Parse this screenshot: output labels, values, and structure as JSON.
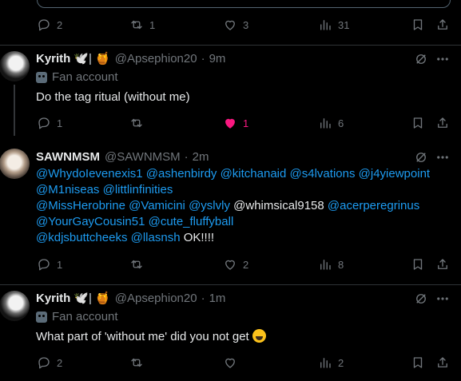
{
  "top_tweet": {
    "actions": {
      "replies": "2",
      "retweets": "1",
      "likes": "3",
      "views": "31"
    }
  },
  "tweets": [
    {
      "name": "Kyrith",
      "name_decor": "🕊️| 🍯",
      "handle": "@Apsephion20",
      "time": "9m",
      "label": "Fan account",
      "text": "Do the tag ritual (without me)",
      "actions": {
        "replies": "1",
        "retweets": "",
        "likes": "1",
        "views": "6"
      },
      "liked": true
    },
    {
      "name": "SAWNMSM",
      "handle": "@SAWNMSM",
      "time": "2m",
      "mentions_line1": [
        "@WhydoIevenexis1",
        "@ashenbirdy",
        "@kitchanaid",
        "@s4lvations",
        "@j4yiewpoint"
      ],
      "mentions_line2": [
        "@M1niseas",
        "@littlinfinities"
      ],
      "mentions_line3_a": [
        "@MissHerobrine",
        "@Vamicini",
        "@yslvly"
      ],
      "plain_mention": "@whimsical9158",
      "mentions_line3_b": [
        "@acerperegrinus"
      ],
      "mentions_line4": [
        "@YourGayCousin51",
        "@cute_fluffyball"
      ],
      "mentions_line5": [
        "@kdjsbuttcheeks",
        "@llasnsh"
      ],
      "trailing": "OK!!!!",
      "actions": {
        "replies": "1",
        "retweets": "",
        "likes": "2",
        "views": "8"
      }
    },
    {
      "name": "Kyrith",
      "name_decor": "🕊️| 🍯",
      "handle": "@Apsephion20",
      "time": "1m",
      "label": "Fan account",
      "text": "What part of 'without me' did you not get",
      "actions": {
        "replies": "2",
        "retweets": "",
        "likes": "",
        "views": "2"
      }
    }
  ],
  "icons": [
    "reply-icon",
    "retweet-icon",
    "like-icon",
    "views-icon",
    "bookmark-icon",
    "share-icon",
    "grok-icon",
    "more-icon"
  ],
  "colors": {
    "background": "#000000",
    "text": "#e7e9ea",
    "muted": "#71767b",
    "link": "#1d9bf0",
    "like": "#f91880",
    "divider": "#2f3336"
  }
}
